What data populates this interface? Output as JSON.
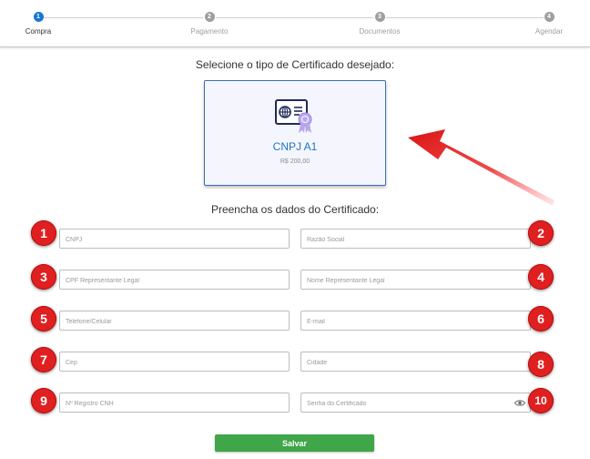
{
  "stepper": {
    "steps": [
      {
        "number": "1",
        "label": "Compra",
        "active": true
      },
      {
        "number": "2",
        "label": "Pagamento",
        "active": false
      },
      {
        "number": "3",
        "label": "Documentos",
        "active": false
      },
      {
        "number": "4",
        "label": "Agendar",
        "active": false
      }
    ]
  },
  "certificate_section": {
    "heading": "Selecione o tipo de Certificado desejado:",
    "card": {
      "title": "CNPJ A1",
      "price": "R$ 200,00",
      "icon": "certificate-icon"
    }
  },
  "form": {
    "heading": "Preencha os dados do Certificado:",
    "fields": [
      {
        "placeholder": "CNPJ",
        "value": "",
        "badge": "1"
      },
      {
        "placeholder": "Razão Social",
        "value": "",
        "badge": "2"
      },
      {
        "placeholder": "CPF Representante Legal",
        "value": "",
        "badge": "3"
      },
      {
        "placeholder": "Nome Representante Legal",
        "value": "",
        "badge": "4"
      },
      {
        "placeholder": "Telefone/Celular",
        "value": "",
        "badge": "5"
      },
      {
        "placeholder": "E-mail",
        "value": "",
        "badge": "6"
      },
      {
        "placeholder": "Cep",
        "value": "",
        "badge": "7"
      },
      {
        "placeholder": "Cidade",
        "value": "",
        "badge": "8"
      },
      {
        "placeholder": "Nº Registro CNH",
        "value": "",
        "badge": "9"
      },
      {
        "placeholder": "Senha do Certificado",
        "value": "",
        "badge": "10",
        "icon": "eye-icon"
      }
    ],
    "save_label": "Salvar"
  },
  "colors": {
    "accent": "#1976d2",
    "card_title": "#1e72c8",
    "badge": "#e02020",
    "save_button": "#3fa64a",
    "arrow": "#e01a1a"
  }
}
